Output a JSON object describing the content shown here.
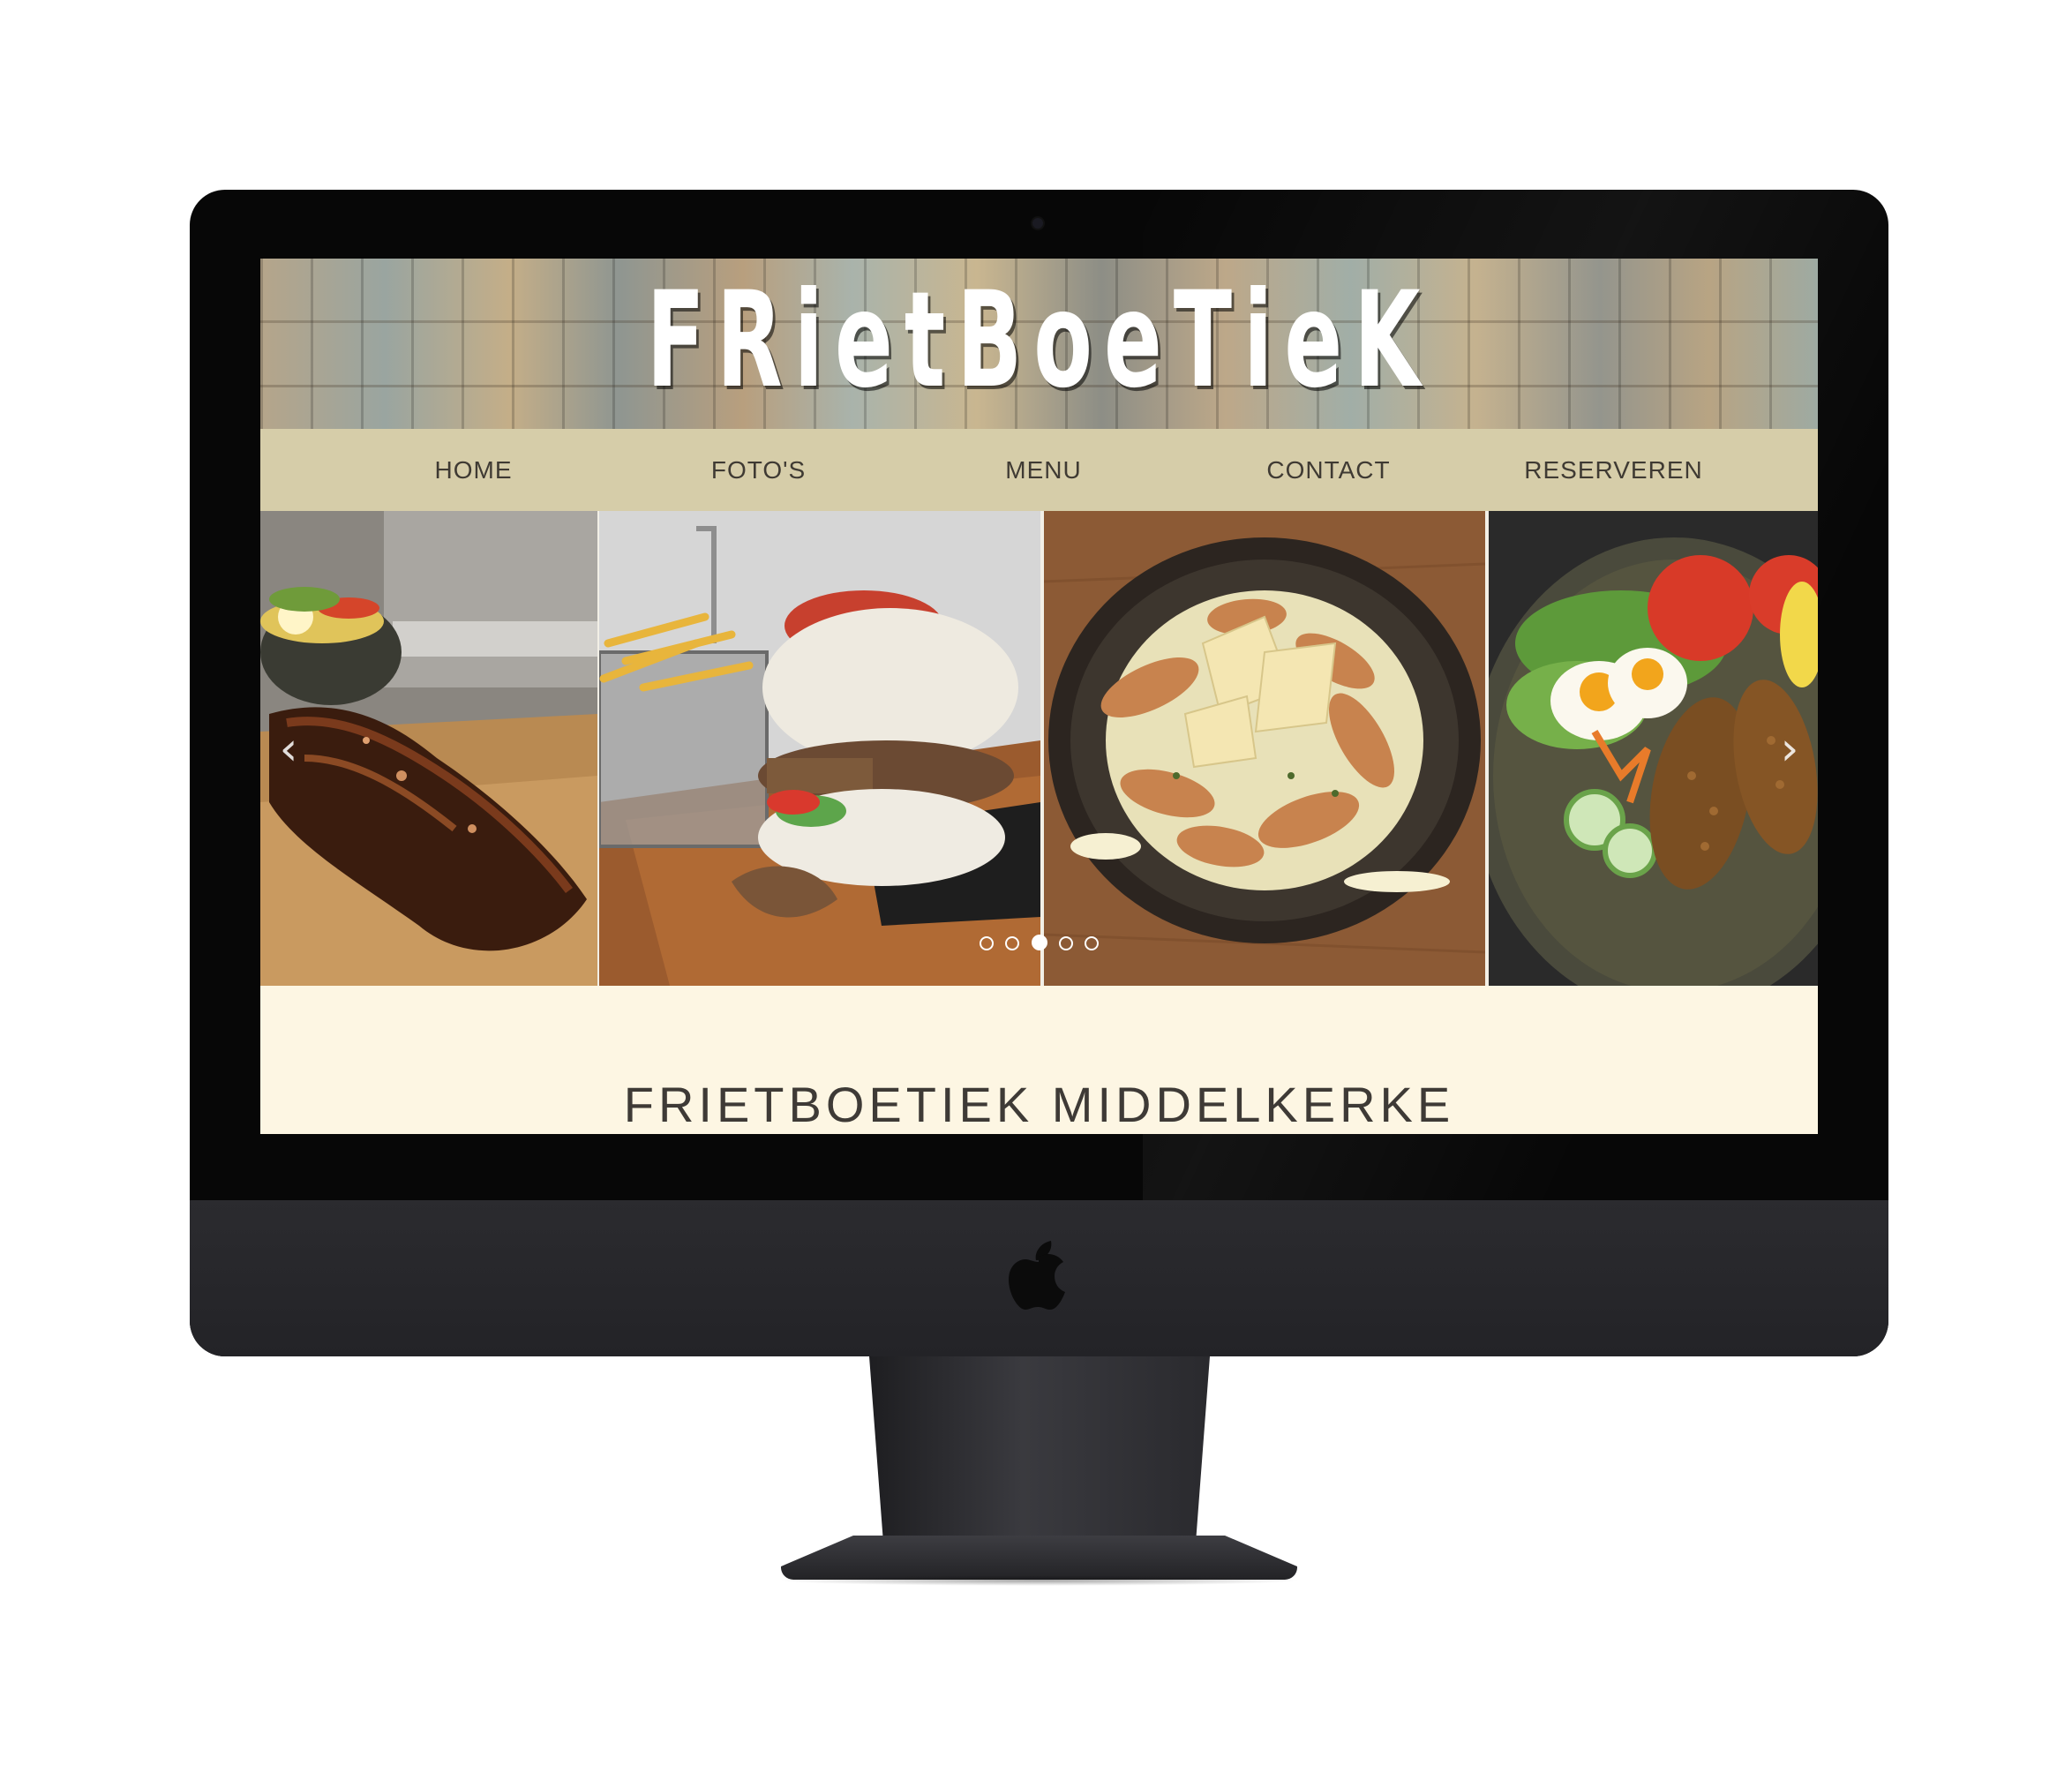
{
  "site": {
    "logo_text": "FRietBoeTieK",
    "nav": [
      {
        "label": "HOME"
      },
      {
        "label": "FOTO'S"
      },
      {
        "label": "MENU"
      },
      {
        "label": "CONTACT"
      },
      {
        "label": "RESERVEREN"
      }
    ],
    "carousel": {
      "slides": [
        {
          "image": "ribs-plate"
        },
        {
          "image": "kebab-burger-with-fries"
        },
        {
          "image": "chicken-caesar-salad-bowl"
        },
        {
          "image": "croquettes-with-salad"
        }
      ],
      "indicator_count": 5,
      "active_indicator": 3,
      "prev_icon": "chevron-left-icon",
      "next_icon": "chevron-right-icon"
    },
    "heading": "FRIETBOETIEK MIDDELKERKE"
  },
  "device": {
    "type": "imac",
    "logo_icon": "apple-logo-icon"
  }
}
